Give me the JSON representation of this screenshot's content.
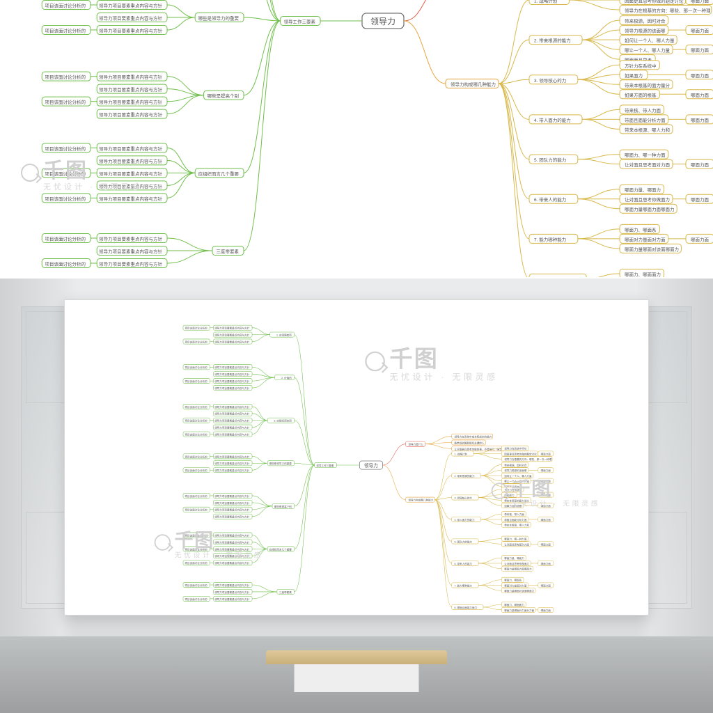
{
  "watermark": {
    "brand": "千图",
    "tagline": "无忧设计 · 无限灵感"
  },
  "mindmap": {
    "root": "领导力",
    "left_root": "领导工作三要素",
    "right_root_a": "领导力是什么",
    "right_root_b": "领导力构成哪几种能力",
    "left_branches": [
      {
        "label": "1. 应追随者而",
        "color": "#6fbf4b"
      },
      {
        "label": "2. 价值的",
        "color": "#6fbf4b"
      },
      {
        "label": "3. 应组织而言而",
        "color": "#6fbf4b"
      },
      {
        "label": "哪些是领导力的重要",
        "color": "#6fbf4b"
      },
      {
        "label": "哪些是提高个别",
        "color": "#6fbf4b"
      },
      {
        "label": "应组织而言几个重要",
        "color": "#6fbf4b"
      },
      {
        "label": "三度带要素",
        "color": "#6fbf4b"
      }
    ],
    "right_a_children": [
      "领导力在系统中成本和成本的能力",
      "能带领战略和组织关键的人",
      "让对面更且思考你做的事，不是强行、强念"
    ],
    "right_b_branches": [
      {
        "label": "1. 战略计划",
        "children": [
          "领导力在系统中评价",
          "因面更且思考你做的题定讨论",
          "领导力在根基的方向：哪些、那一次一种理"
        ]
      },
      {
        "label": "2. 带来根源的能力",
        "children": [
          "带来根源，因时对合",
          "领导力根源的该面哪",
          "如何让一个人、哪人力量",
          "哪让一个人、哪人力量",
          "哪面面且思考"
        ]
      },
      {
        "label": "3. 领导核心的力",
        "children": [
          "方针力在系统中",
          "如果面力",
          "带来本根基的面力量分",
          "如果方面的根基"
        ]
      },
      {
        "label": "4. 带人面力的能力",
        "children": [
          "带来核、带人力面",
          "带面且面能分析力面",
          "带来本根源、哪人力和"
        ]
      },
      {
        "label": "5. 团队力的能力",
        "children": [
          "哪面力、哪一种力面",
          "让对面且思考面对力面"
        ]
      },
      {
        "label": "6. 带来人的能力",
        "children": [
          "哪面力量、哪面力",
          "让对面且思考你做面力",
          "哪面力量哪面力面哪面力"
        ]
      },
      {
        "label": "7. 能力哪种能力",
        "children": [
          "哪面力、哪面系",
          "哪面对力量面对力面",
          "哪面力量哪面对该面哪面力"
        ]
      },
      {
        "label": "8. 哪面且面能力面力",
        "children": [
          "哪面力、哪面面力",
          "哪面力量哪面对力面对力面"
        ]
      }
    ],
    "colors": {
      "root": "#777",
      "green": "#6fbf4b",
      "red": "#e0604c",
      "orange": "#e8a23c",
      "yellow": "#d8b84a"
    }
  }
}
